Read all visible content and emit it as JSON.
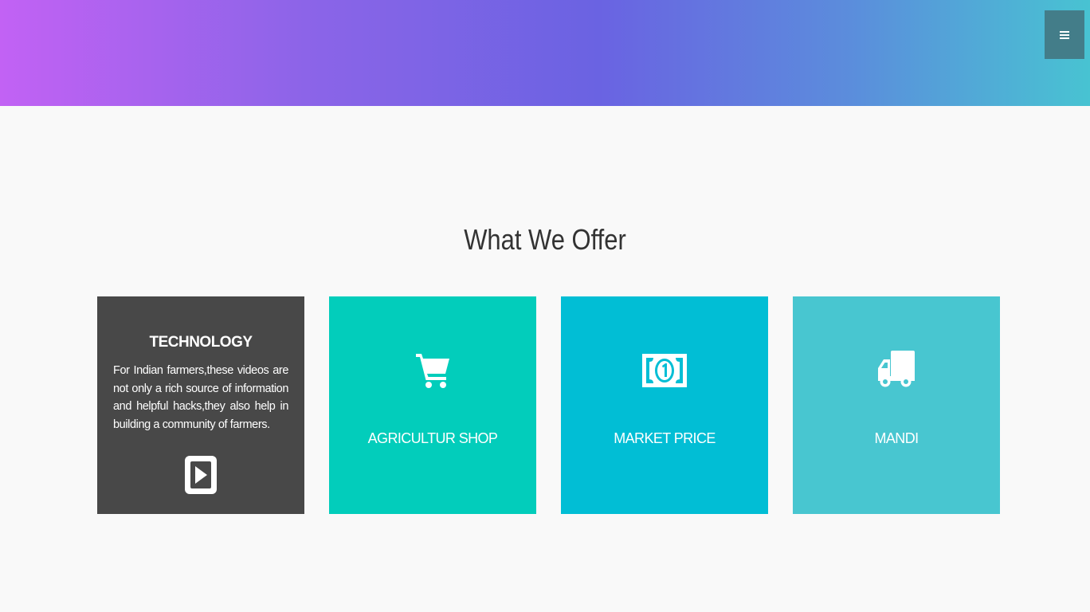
{
  "header": {
    "menu_icon": "hamburger-menu-icon"
  },
  "section": {
    "title": "What We Offer"
  },
  "cards": {
    "technology": {
      "heading": "TECHNOLOGY",
      "description": "For Indian farmers,these videos are not only a rich source of information and helpful hacks,they also help in building a community of farmers.",
      "icon": "play-icon",
      "color": "#484848"
    },
    "shop": {
      "label": "AGRICULTUR SHOP",
      "icon": "shopping-cart-icon",
      "color": "#02cdbb"
    },
    "price": {
      "label": "MARKET PRICE",
      "icon": "money-bill-icon",
      "color": "#01bed5"
    },
    "mandi": {
      "label": "MANDI",
      "icon": "truck-icon",
      "color": "#48c6d0"
    }
  }
}
